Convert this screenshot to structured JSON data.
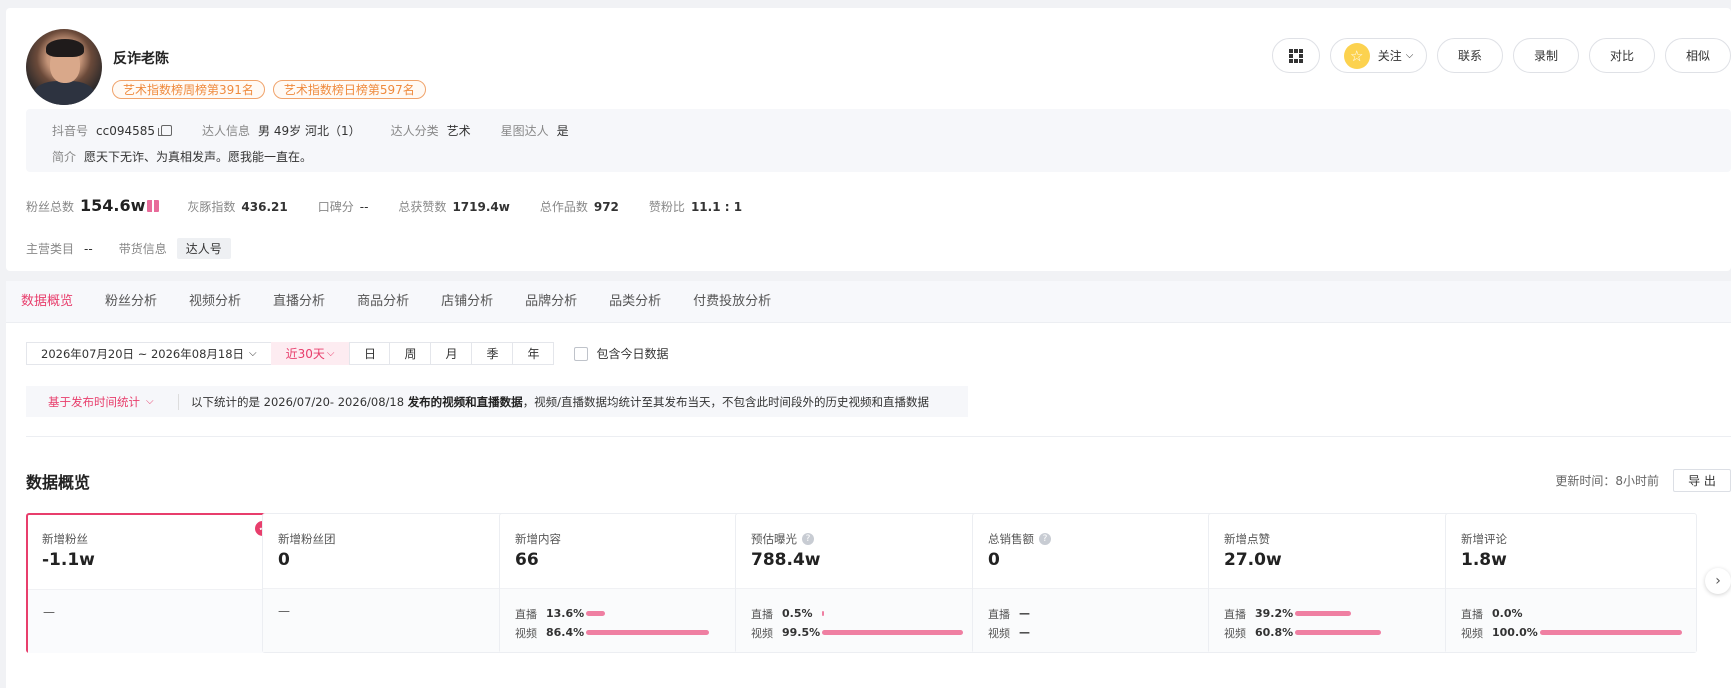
{
  "profile": {
    "name": "反诈老陈",
    "rank_tags": [
      "艺术指数榜周榜第391名",
      "艺术指数榜日榜第597名"
    ]
  },
  "actions": {
    "follow_label": "关注",
    "contact_label": "联系",
    "record_label": "录制",
    "compare_label": "对比",
    "similar_label": "相似"
  },
  "info": {
    "douyin_id_label": "抖音号",
    "douyin_id": "cc094585",
    "talent_info_label": "达人信息",
    "talent_info": "男 49岁 河北（1）",
    "category_label": "达人分类",
    "category": "艺术",
    "star_label": "星图达人",
    "star": "是",
    "bio_label": "简介",
    "bio": "愿天下无诈、为真相发声。愿我能一直在。"
  },
  "stats": {
    "fans_label": "粉丝总数",
    "fans": "154.6w",
    "hui_label": "灰豚指数",
    "hui": "436.21",
    "reputation_label": "口碑分",
    "reputation": "--",
    "likes_label": "总获赞数",
    "likes": "1719.4w",
    "works_label": "总作品数",
    "works": "972",
    "ratio_label": "赞粉比",
    "ratio": "11.1 : 1"
  },
  "row3": {
    "main_cat_label": "主营类目",
    "main_cat": "--",
    "goods_label": "带货信息",
    "goods": "达人号"
  },
  "tabs": [
    "数据概览",
    "粉丝分析",
    "视频分析",
    "直播分析",
    "商品分析",
    "店铺分析",
    "品牌分析",
    "品类分析",
    "付费投放分析"
  ],
  "filters": {
    "date_range": "2026年07月20日 ~ 2026年08月18日",
    "preset": "近30天",
    "segments": [
      "日",
      "周",
      "月",
      "季",
      "年"
    ],
    "include_today": "包含今日数据"
  },
  "notice": {
    "select": "基于发布时间统计",
    "prefix": "以下统计的是 2026/07/20- 2026/08/18 ",
    "bold": "发布的视频和直播数据",
    "suffix": "，视频/直播数据均统计至其发布当天，不包含此时间段外的历史视频和直播数据"
  },
  "section": {
    "title": "数据概览",
    "update": "更新时间：8小时前",
    "export": "导 出"
  },
  "cards": [
    {
      "label": "新增粉丝",
      "value": "-1.1w",
      "dash": "—"
    },
    {
      "label": "新增粉丝团",
      "value": "0",
      "dash": "—"
    },
    {
      "label": "新增内容",
      "value": "66",
      "live_label": "直播",
      "live_pct": "13.6%",
      "live_frac": 0.136,
      "video_label": "视频",
      "video_pct": "86.4%",
      "video_frac": 0.864
    },
    {
      "label": "预估曝光",
      "value": "788.4w",
      "live_label": "直播",
      "live_pct": "0.5%",
      "live_frac": 0.005,
      "video_label": "视频",
      "video_pct": "99.5%",
      "video_frac": 0.995
    },
    {
      "label": "总销售额",
      "value": "0",
      "live_label": "直播",
      "live_pct": "—",
      "video_label": "视频",
      "video_pct": "—"
    },
    {
      "label": "新增点赞",
      "value": "27.0w",
      "live_label": "直播",
      "live_pct": "39.2%",
      "live_frac": 0.392,
      "video_label": "视频",
      "video_pct": "60.8%",
      "video_frac": 0.608
    },
    {
      "label": "新增评论",
      "value": "1.8w",
      "live_label": "直播",
      "live_pct": "0.0%",
      "live_frac": 0.0,
      "video_label": "视频",
      "video_pct": "100.0%",
      "video_frac": 1.0
    }
  ],
  "colors": {
    "accent": "#e83e6c",
    "bar": "#ef7fa2",
    "tag_orange": "#ef8a3d"
  }
}
